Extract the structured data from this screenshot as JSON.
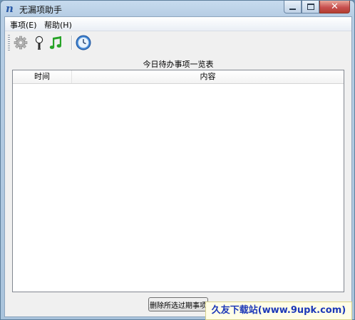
{
  "window": {
    "title": "无漏项助手",
    "app_icon_glyph": "n",
    "close_glyph": "✕"
  },
  "menu": [
    {
      "label": "事项(E)"
    },
    {
      "label": "帮助(H)"
    }
  ],
  "toolbar": {
    "icons": [
      "gear-icon",
      "lightbulb-icon",
      "music-note-icon",
      "clock-icon"
    ],
    "colors": {
      "music_note": "#27a327",
      "clock_ring": "#3a7fd0"
    }
  },
  "list": {
    "caption": "今日待办事项一览表",
    "columns": [
      {
        "label": "时间"
      },
      {
        "label": "内容"
      }
    ],
    "rows": []
  },
  "buttons": {
    "delete_expired": "删除所选过期事项"
  },
  "watermark": {
    "text": "久友下载站(www.9upk.com)",
    "color": "#1c38b8"
  }
}
